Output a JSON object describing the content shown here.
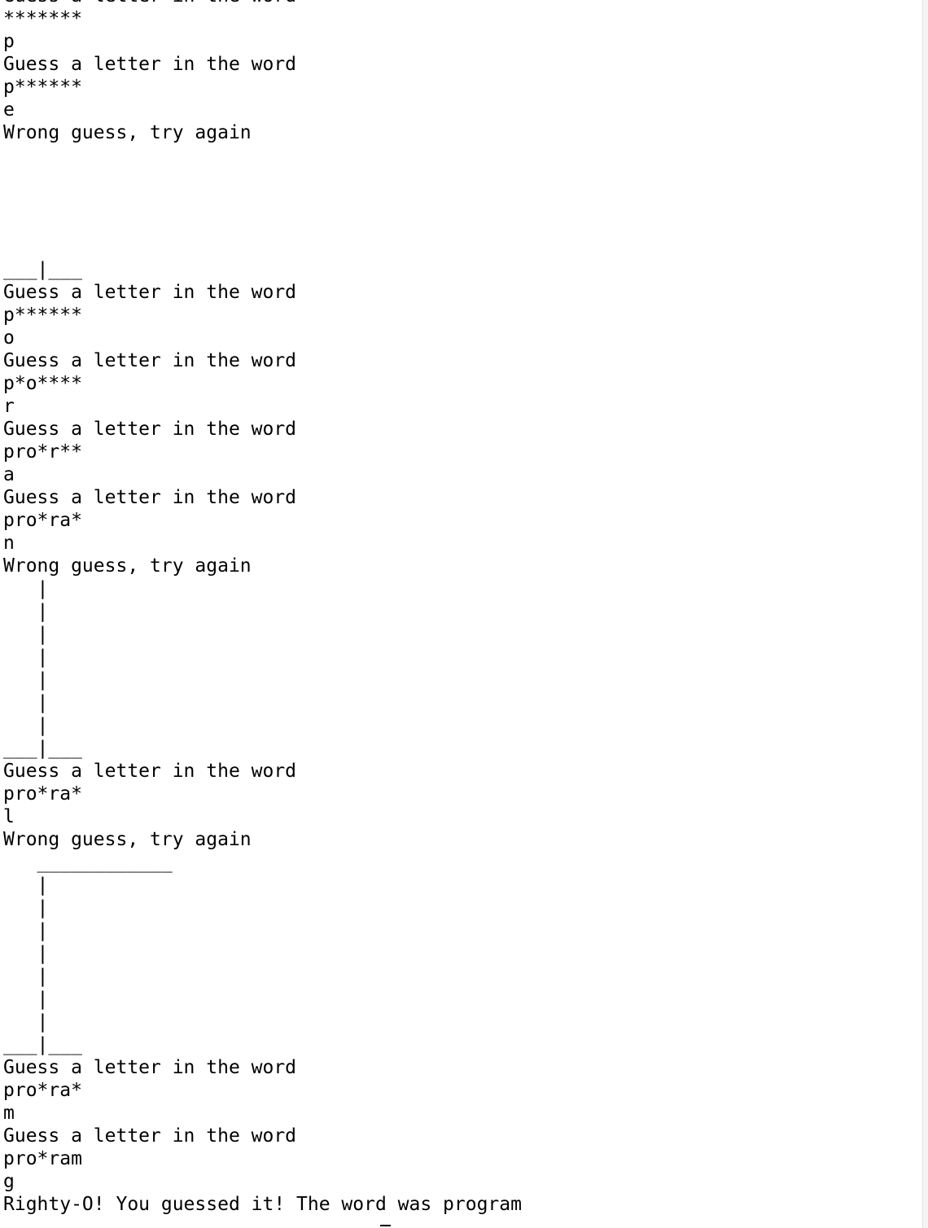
{
  "terminal": {
    "lines": [
      "Guess a letter in the word",
      "*******",
      "p",
      "Guess a letter in the word",
      "p******",
      "e",
      "Wrong guess, try again",
      "",
      "",
      "",
      "",
      "",
      "___|___",
      "Guess a letter in the word",
      "p******",
      "o",
      "Guess a letter in the word",
      "p*o****",
      "r",
      "Guess a letter in the word",
      "pro*r**",
      "a",
      "Guess a letter in the word",
      "pro*ra*",
      "n",
      "Wrong guess, try again",
      "   |",
      "   |",
      "   |",
      "   |",
      "   |",
      "   |",
      "   |",
      "___|___",
      "Guess a letter in the word",
      "pro*ra*",
      "l",
      "Wrong guess, try again",
      "   ____________",
      "   |",
      "   |",
      "   |",
      "   |",
      "   |",
      "   |",
      "   |",
      "___|___",
      "Guess a letter in the word",
      "pro*ra*",
      "m",
      "Guess a letter in the word",
      "pro*ram",
      "g",
      "Righty-O! You guessed it! The word was program"
    ]
  }
}
